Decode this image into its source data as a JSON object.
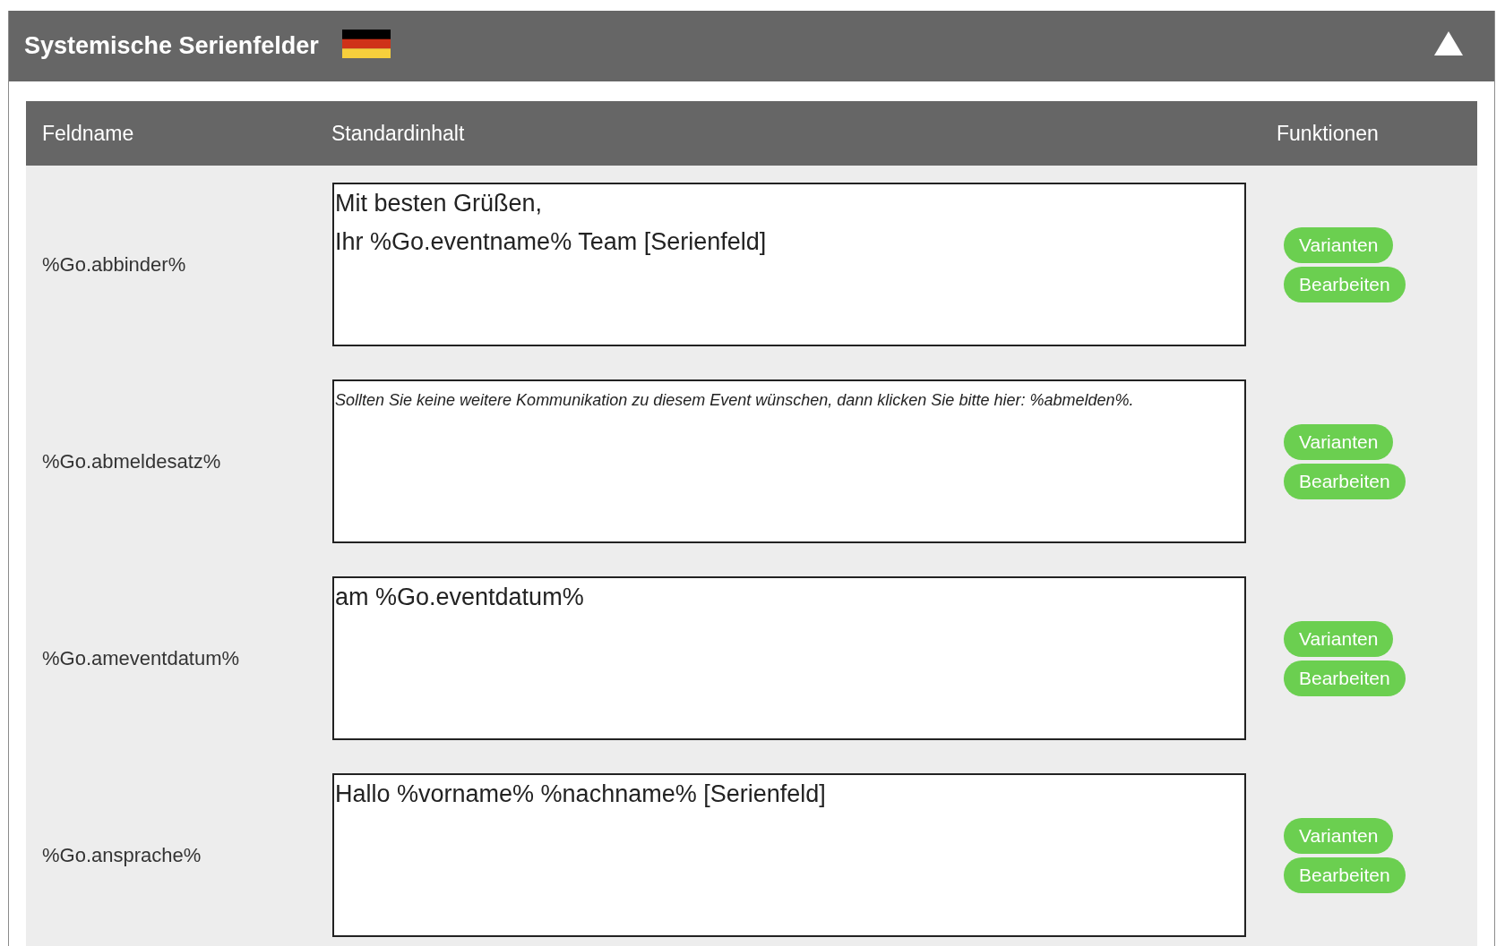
{
  "panel": {
    "title": "Systemische Serienfelder",
    "expanded": true
  },
  "table": {
    "columns": [
      "Feldname",
      "Standardinhalt",
      "Funktionen"
    ],
    "rows": [
      {
        "field_name": "%Go.abbinder%",
        "content": "Mit besten Grüßen,\nIhr %Go.eventname% Team [Serienfeld]",
        "italic": false,
        "buttons": [
          "Varianten",
          "Bearbeiten"
        ]
      },
      {
        "field_name": "%Go.abmeldesatz%",
        "content": "Sollten Sie keine weitere Kommunikation zu diesem Event wünschen, dann klicken Sie bitte hier: %abmelden%.",
        "italic": true,
        "buttons": [
          "Varianten",
          "Bearbeiten"
        ]
      },
      {
        "field_name": "%Go.ameventdatum%",
        "content": "am %Go.eventdatum%",
        "italic": false,
        "buttons": [
          "Varianten",
          "Bearbeiten"
        ]
      },
      {
        "field_name": "%Go.ansprache%",
        "content": "Hallo %vorname% %nachname% [Serienfeld]",
        "italic": false,
        "buttons": [
          "Varianten",
          "Bearbeiten"
        ]
      }
    ]
  }
}
